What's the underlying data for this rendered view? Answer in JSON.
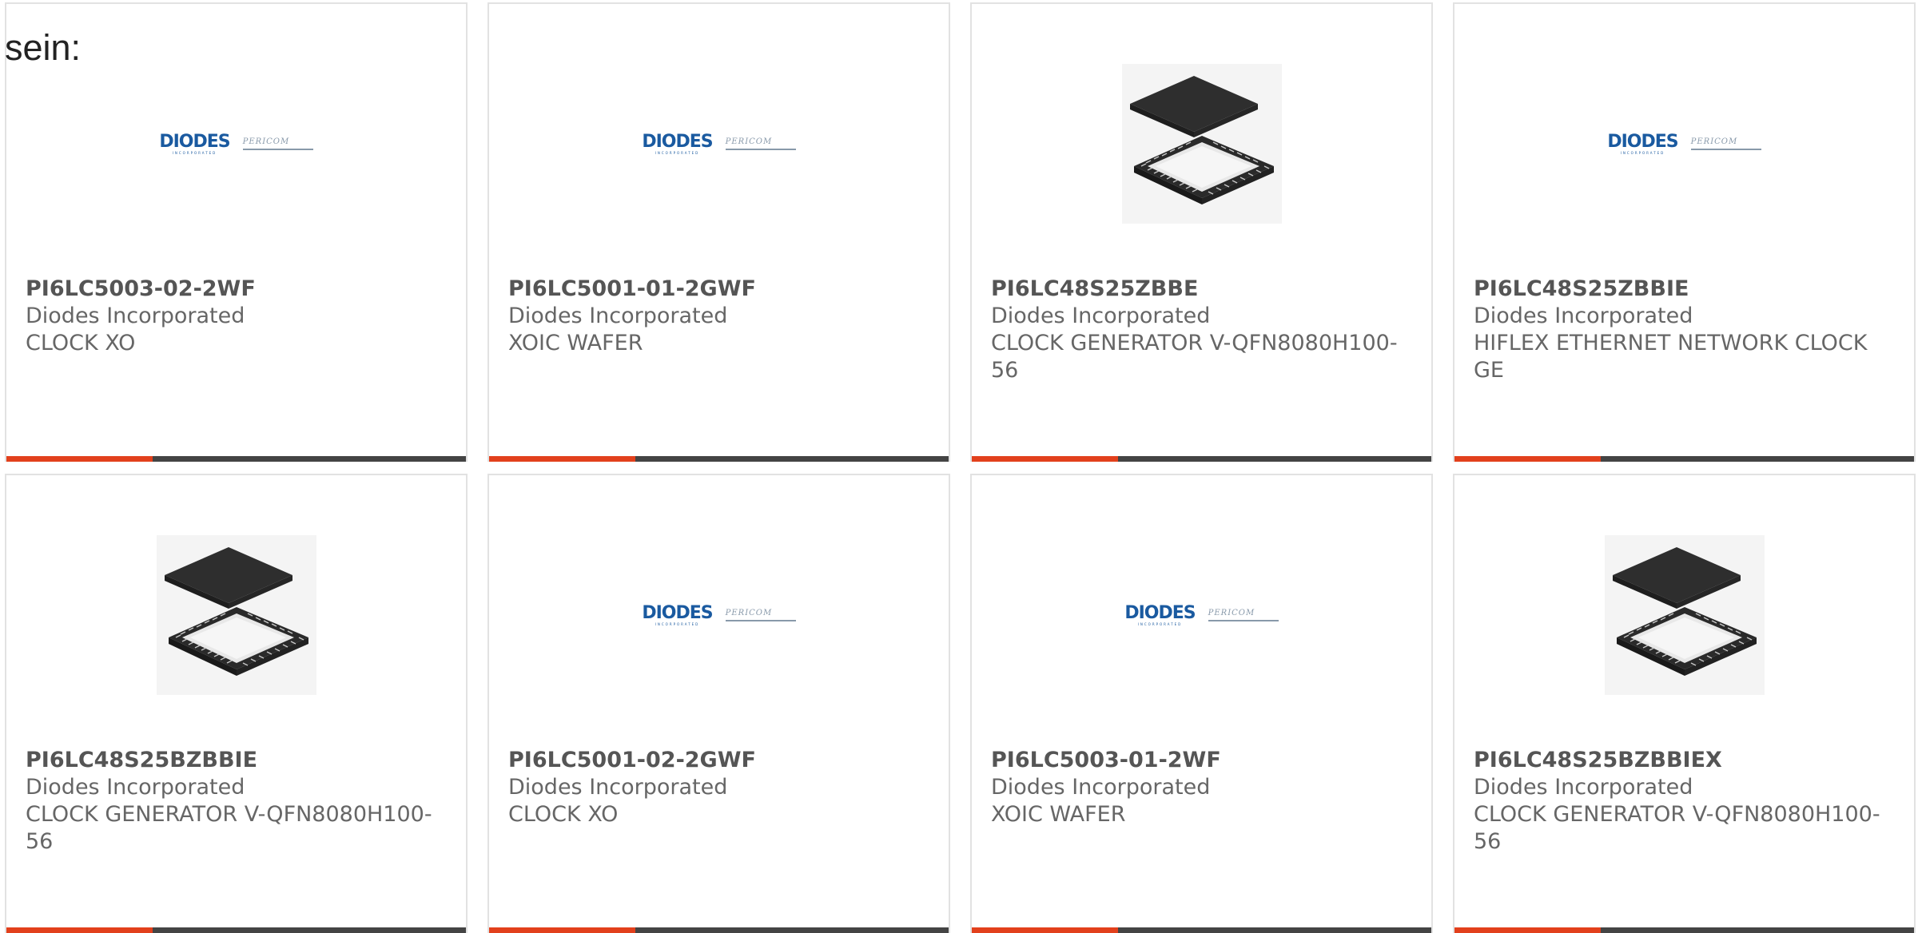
{
  "intro_text": "sein:",
  "colors": {
    "accent": "#e2401c",
    "bar": "#444444",
    "logo_blue": "#1a5aa0",
    "pericom_gray": "#8899aa"
  },
  "logo": {
    "brand": "DIODES",
    "brand_sub": "INCORPORATED",
    "partner": "PERICOM"
  },
  "products": [
    {
      "part_number": "PI6LC5003-02-2WF",
      "manufacturer": "Diodes Incorporated",
      "description": "CLOCK XO",
      "image": "diodes-pericom-logo"
    },
    {
      "part_number": "PI6LC5001-01-2GWF",
      "manufacturer": "Diodes Incorporated",
      "description": "XOIC WAFER",
      "image": "diodes-pericom-logo"
    },
    {
      "part_number": "PI6LC48S25ZBBE",
      "manufacturer": "Diodes Incorporated",
      "description": "CLOCK GENERATOR V-QFN8080H100-56",
      "image": "qfn-chip"
    },
    {
      "part_number": "PI6LC48S25ZBBIE",
      "manufacturer": "Diodes Incorporated",
      "description": "HIFLEX ETHERNET NETWORK CLOCK GE",
      "image": "diodes-pericom-logo"
    },
    {
      "part_number": "PI6LC48S25BZBBIE",
      "manufacturer": "Diodes Incorporated",
      "description": "CLOCK GENERATOR V-QFN8080H100-56",
      "image": "qfn-chip"
    },
    {
      "part_number": "PI6LC5001-02-2GWF",
      "manufacturer": "Diodes Incorporated",
      "description": "CLOCK XO",
      "image": "diodes-pericom-logo"
    },
    {
      "part_number": "PI6LC5003-01-2WF",
      "manufacturer": "Diodes Incorporated",
      "description": "XOIC WAFER",
      "image": "diodes-pericom-logo"
    },
    {
      "part_number": "PI6LC48S25BZBBIEX",
      "manufacturer": "Diodes Incorporated",
      "description": "CLOCK GENERATOR V-QFN8080H100-56",
      "image": "qfn-chip"
    }
  ]
}
